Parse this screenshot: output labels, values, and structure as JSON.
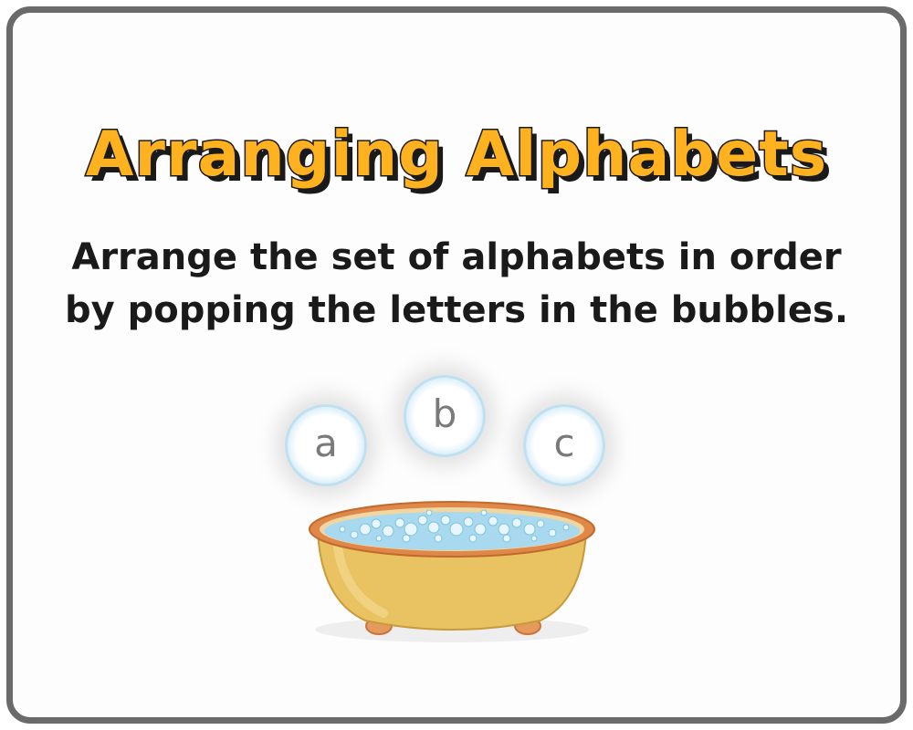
{
  "title": "Arranging Alphabets",
  "instructions": {
    "line1": "Arrange the set of alphabets in order",
    "line2": "by popping the letters in the bubbles."
  },
  "bubbles": [
    {
      "letter": "a"
    },
    {
      "letter": "b"
    },
    {
      "letter": "c"
    }
  ],
  "colors": {
    "title_fill": "#ffb21f",
    "title_outline": "#1a1a1a",
    "frame_border": "#6a6a6a",
    "tub_body": "#e9c262",
    "tub_rim": "#e0884a",
    "water": "#a9d9ef",
    "letter": "#7a7a7a"
  },
  "icons": {
    "tub": "bathtub-icon",
    "bubble": "bubble-icon"
  }
}
